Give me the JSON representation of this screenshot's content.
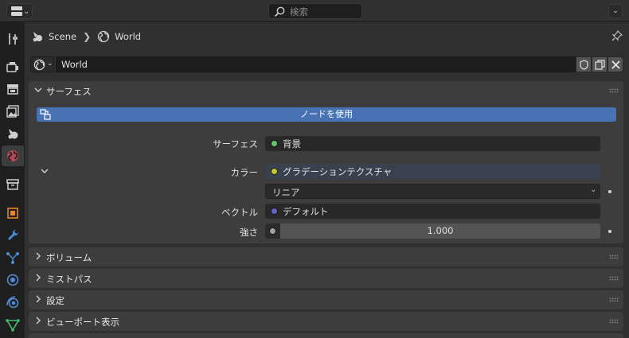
{
  "header": {
    "search_placeholder": "検索",
    "editor_icon": "properties-editor-icon",
    "menu_icon": "chevron-down-icon"
  },
  "sidebar": {
    "tabs": [
      {
        "name": "tool",
        "icon": "tool-icon"
      },
      {
        "name": "render",
        "icon": "render-icon"
      },
      {
        "name": "output",
        "icon": "output-icon"
      },
      {
        "name": "view-layer",
        "icon": "view-layer-icon"
      },
      {
        "name": "scene",
        "icon": "scene-icon"
      },
      {
        "name": "world",
        "icon": "world-icon",
        "active": true
      },
      {
        "name": "collection",
        "icon": "collection-icon"
      },
      {
        "name": "object",
        "icon": "object-icon"
      },
      {
        "name": "modifiers",
        "icon": "wrench-icon"
      },
      {
        "name": "particles",
        "icon": "particles-icon"
      },
      {
        "name": "physics",
        "icon": "physics-icon"
      },
      {
        "name": "constraints",
        "icon": "constraints-icon"
      },
      {
        "name": "data",
        "icon": "mesh-data-icon"
      }
    ]
  },
  "breadcrumb": {
    "scene": "Scene",
    "world": "World"
  },
  "id_block": {
    "name": "World"
  },
  "panels": {
    "surface": {
      "title": "サーフェス",
      "use_nodes": "ノードを使用",
      "surface_label": "サーフェス",
      "surface_value": "背景",
      "color_label": "カラー",
      "color_value": "グラデーションテクスチャ",
      "interpolation_value": "リニア",
      "vector_label": "ベクトル",
      "vector_value": "デフォルト",
      "strength_label": "強さ",
      "strength_value": "1.000"
    },
    "volume": {
      "title": "ボリューム"
    },
    "mist": {
      "title": "ミストパス"
    },
    "settings": {
      "title": "設定"
    },
    "viewport": {
      "title": "ビューポート表示"
    }
  },
  "colors": {
    "accent": "#4772b3",
    "socket_shader": "#63c763",
    "socket_color": "#c7c729",
    "socket_vector": "#6363c7",
    "socket_float": "#a1a1a1"
  }
}
